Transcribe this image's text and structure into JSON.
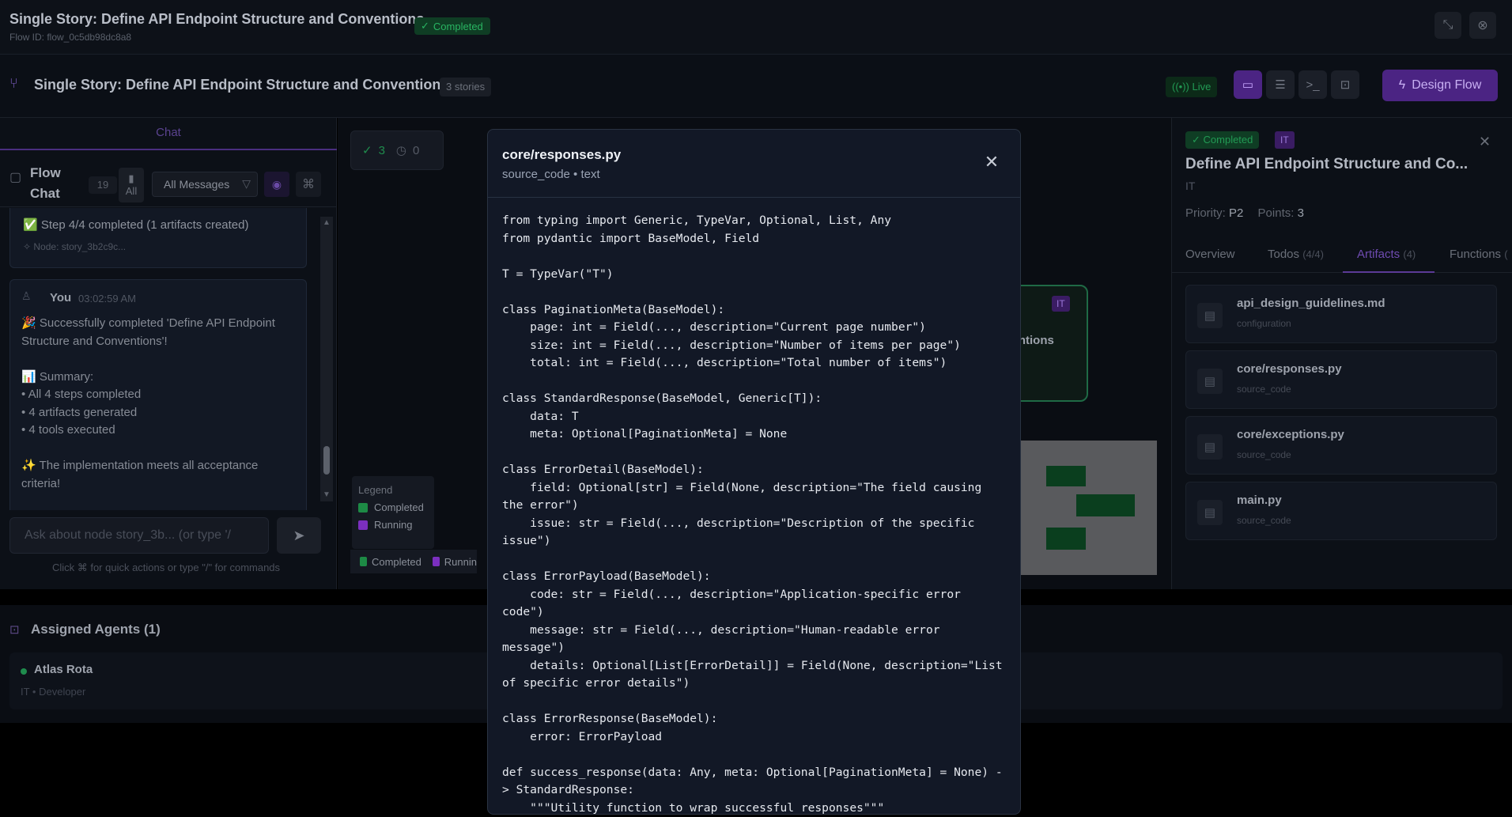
{
  "app": {
    "title": "Single Story: Define API Endpoint Structure and Conventions",
    "flow_id": "Flow ID: flow_0c5db98dc8a8",
    "status": "Completed"
  },
  "toolbar": {
    "title": "Single Story: Define API Endpoint Structure and Conventions",
    "stories": "3 stories",
    "live": "Live",
    "design_flow": "Design Flow"
  },
  "chat": {
    "tab": "Chat",
    "title": "Flow Chat",
    "count": "19",
    "all_label": "All",
    "filter_value": "All Messages",
    "step_message": "✅ Step 4/4 completed (1 artifacts created)",
    "node_ref": "Node: story_3b2c9c...",
    "message_author": "You",
    "message_time": "03:02:59 AM",
    "message_body": "🎉 Successfully completed 'Define API Endpoint Structure and Conventions'!\n\n📊 Summary:\n• All 4 steps completed\n• 4 artifacts generated\n• 4 tools executed\n\n✨ The implementation meets all acceptance criteria!",
    "input_placeholder": "Ask about node story_3b... (or type '/",
    "hint": "Click ⌘ for quick actions or type \"/\" for commands"
  },
  "canvas": {
    "completed_count": "3",
    "pending_count": "0",
    "legend_title": "Legend",
    "legend": [
      {
        "label": "Completed",
        "color": "#1d8a45"
      },
      {
        "label": "Running",
        "color": "#7b2fbf"
      }
    ],
    "legend2": [
      {
        "label": "Completed",
        "color": "#1d8a45"
      },
      {
        "label": "Runnin",
        "color": "#7b2fbf"
      }
    ],
    "node_badge": "IT",
    "node_label": "nventions"
  },
  "detail": {
    "status": "Completed",
    "dept": "IT",
    "title": "Define API Endpoint Structure and Co...",
    "subtitle": "IT",
    "priority_label": "Priority:",
    "priority": "P2",
    "points_label": "Points:",
    "points": "3",
    "tabs": [
      {
        "label": "Overview",
        "count": ""
      },
      {
        "label": "Todos",
        "count": "(4/4)"
      },
      {
        "label": "Artifacts",
        "count": "(4)"
      },
      {
        "label": "Functions",
        "count": "("
      }
    ],
    "artifacts": [
      {
        "name": "api_design_guidelines.md",
        "kind": "configuration"
      },
      {
        "name": "core/responses.py",
        "kind": "source_code"
      },
      {
        "name": "core/exceptions.py",
        "kind": "source_code"
      },
      {
        "name": "main.py",
        "kind": "source_code"
      }
    ]
  },
  "agents": {
    "title": "Assigned Agents (1)",
    "name": "Atlas Rota",
    "role": "IT • Developer"
  },
  "modal": {
    "title": "core/responses.py",
    "subtitle": "source_code • text",
    "code": "from typing import Generic, TypeVar, Optional, List, Any\nfrom pydantic import BaseModel, Field\n\nT = TypeVar(\"T\")\n\nclass PaginationMeta(BaseModel):\n    page: int = Field(..., description=\"Current page number\")\n    size: int = Field(..., description=\"Number of items per page\")\n    total: int = Field(..., description=\"Total number of items\")\n\nclass StandardResponse(BaseModel, Generic[T]):\n    data: T\n    meta: Optional[PaginationMeta] = None\n\nclass ErrorDetail(BaseModel):\n    field: Optional[str] = Field(None, description=\"The field causing the error\")\n    issue: str = Field(..., description=\"Description of the specific issue\")\n\nclass ErrorPayload(BaseModel):\n    code: str = Field(..., description=\"Application-specific error code\")\n    message: str = Field(..., description=\"Human-readable error message\")\n    details: Optional[List[ErrorDetail]] = Field(None, description=\"List of specific error details\")\n\nclass ErrorResponse(BaseModel):\n    error: ErrorPayload\n\ndef success_response(data: Any, meta: Optional[PaginationMeta] = None) -> StandardResponse:\n    \"\"\"Utility function to wrap successful responses\"\"\"\n    return StandardResponse(data=data, meta=meta)"
  }
}
